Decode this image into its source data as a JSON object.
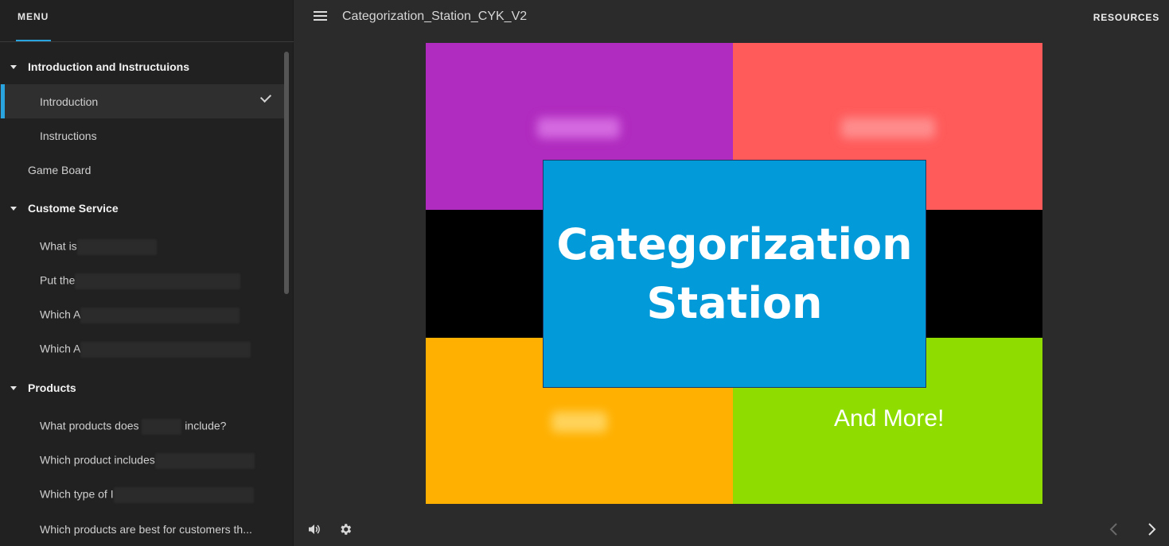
{
  "sidebar": {
    "menu_label": "MENU",
    "sections": [
      {
        "title": "Introduction and Instructuions",
        "items": [
          {
            "label": "Introduction",
            "active": true,
            "completed": true
          },
          {
            "label": "Instructions"
          }
        ]
      },
      {
        "title": "Game Board"
      },
      {
        "title": "Custome Service",
        "items": [
          {
            "label": "What is"
          },
          {
            "label": "Put the"
          },
          {
            "label": "Which A"
          },
          {
            "label": "Which A"
          }
        ]
      },
      {
        "title": "Products",
        "items": [
          {
            "label_before": "What products does",
            "label_after": "include?"
          },
          {
            "label": "Which product includes"
          },
          {
            "label": "Which type of I"
          },
          {
            "label": "Which products are best for customers th..."
          }
        ]
      }
    ]
  },
  "topbar": {
    "course_title": "Categorization_Station_CYK_V2",
    "resources_label": "RESOURCES"
  },
  "slide": {
    "title_line1": "Categorization",
    "title_line2": "Station",
    "tile_label_green": "And More!",
    "colors": {
      "purple": "#b02bbf",
      "red": "#ff5b5b",
      "orange": "#ffb000",
      "green": "#8fdd00",
      "center": "#039ad9"
    }
  },
  "controls": {
    "icons": [
      "volume-icon",
      "gear-icon",
      "chevron-left-icon",
      "chevron-right-icon"
    ]
  }
}
